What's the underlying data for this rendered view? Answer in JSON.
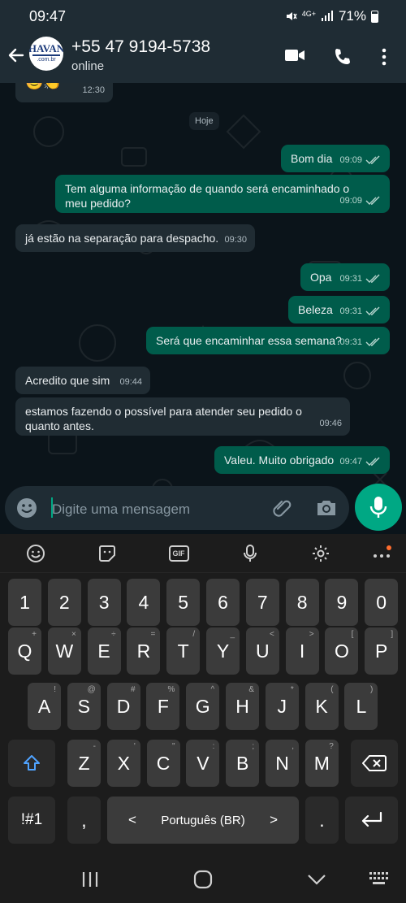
{
  "status_bar": {
    "time": "09:47",
    "network": "4G+",
    "battery": "71%"
  },
  "header": {
    "name": "+55 47 9194-5738",
    "status": "online",
    "avatar_text_top": "HAVAN",
    "avatar_text_bottom": ".com.br"
  },
  "chat": {
    "first_time": "12:30",
    "first_emoji": "😊👏",
    "date_chip": "Hoje",
    "messages": [
      {
        "text": "Bom dia",
        "time": "09:09"
      },
      {
        "text": "Tem alguma informação de quando será encaminhado o meu pedido?",
        "time": "09:09"
      },
      {
        "text": "já estão na separação para despacho.",
        "time": "09:30"
      },
      {
        "text": "Opa",
        "time": "09:31"
      },
      {
        "text": "Beleza",
        "time": "09:31"
      },
      {
        "text": "Será que encaminhar essa semana?",
        "time": "09:31"
      },
      {
        "text": "Acredito que sim",
        "time": "09:44"
      },
      {
        "text": "estamos fazendo o possível para atender seu pedido o quanto antes.",
        "time": "09:46"
      },
      {
        "text": "Valeu. Muito obrigado",
        "time": "09:47"
      }
    ]
  },
  "composer": {
    "placeholder": "Digite uma mensagem"
  },
  "keyboard": {
    "gif_label": "GIF",
    "numbers": [
      "1",
      "2",
      "3",
      "4",
      "5",
      "6",
      "7",
      "8",
      "9",
      "0"
    ],
    "row1": [
      "Q",
      "W",
      "E",
      "R",
      "T",
      "Y",
      "U",
      "I",
      "O",
      "P"
    ],
    "row1_sup": [
      "+",
      "×",
      "÷",
      "=",
      "/",
      "_",
      "<",
      ">",
      "[",
      "]"
    ],
    "row2": [
      "A",
      "S",
      "D",
      "F",
      "G",
      "H",
      "J",
      "K",
      "L"
    ],
    "row2_sup": [
      "!",
      "@",
      "#",
      "%",
      "^",
      "&",
      "*",
      "(",
      ")"
    ],
    "row3": [
      "Z",
      "X",
      "C",
      "V",
      "B",
      "N",
      "M"
    ],
    "row3_sup": [
      "-",
      "'",
      "\"",
      ":",
      ";",
      ",",
      "?"
    ],
    "symbols_label": "!#1",
    "comma": ",",
    "space_label": "Português (BR)",
    "period": ".",
    "left_arrow": "<",
    "right_arrow": ">"
  },
  "colors": {
    "accent": "#00a884",
    "outgoing": "#005c4b",
    "incoming": "#202c33",
    "header": "#1f2c34"
  }
}
